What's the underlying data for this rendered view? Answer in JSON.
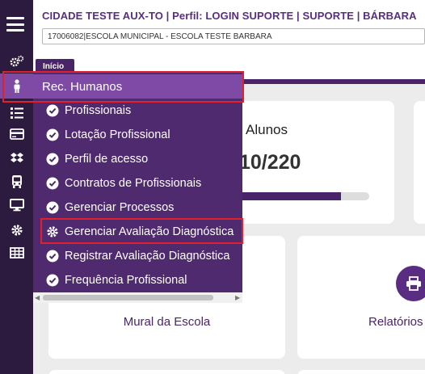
{
  "header": {
    "title": "CIDADE TESTE AUX-TO | Perfil: LOGIN SUPORTE | SUPORTE | BÁRBARA",
    "school_select": "17006082|ESCOLA MUNICIPAL - ESCOLA TESTE BARBARA"
  },
  "breadcrumb": {
    "tab_label": "Início"
  },
  "rail": {
    "icons": [
      "menu-icon",
      "cogs-icon",
      "person-icon",
      "list-icon",
      "card-icon",
      "dropbox-icon",
      "bus-icon",
      "monitor-icon",
      "gear-icon",
      "table-icon"
    ]
  },
  "flyout": {
    "header_label": "Rec. Humanos",
    "items": [
      {
        "label": "Profissionais",
        "icon": "check-circle-icon"
      },
      {
        "label": "Lotação Profissional",
        "icon": "check-circle-icon"
      },
      {
        "label": "Perfil de acesso",
        "icon": "check-circle-icon"
      },
      {
        "label": "Contratos de Profissionais",
        "icon": "check-circle-icon"
      },
      {
        "label": "Gerenciar Processos",
        "icon": "check-circle-icon"
      },
      {
        "label": "Gerenciar Avaliação Diagnóstica",
        "icon": "gear-icon"
      },
      {
        "label": "Registrar Avaliação Diagnóstica",
        "icon": "check-circle-icon"
      },
      {
        "label": "Frequência Profissional",
        "icon": "check-circle-icon"
      }
    ]
  },
  "cards": {
    "alunos": {
      "title": "Alunos",
      "value": "10/220",
      "progress_fraction": 0.8
    },
    "mural": {
      "label": "Mural da Escola"
    },
    "relatorios": {
      "label": "Relatórios"
    }
  },
  "colors": {
    "rail_bg": "#2c1b3f",
    "primary_purple": "#4a2468",
    "menu_bg": "#4f2a6e",
    "menu_highlight": "#7e4aa6",
    "header_text": "#5a2d82",
    "highlight_border": "#e0202a"
  }
}
